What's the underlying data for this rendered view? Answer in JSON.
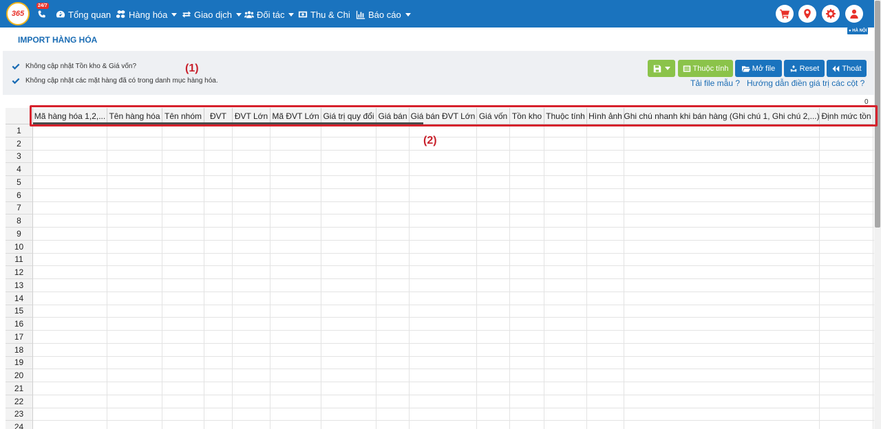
{
  "app": {
    "logo_text": "365",
    "phone_badge": "24/7"
  },
  "nav": {
    "items": [
      {
        "label": "Tổng quan",
        "icon": "dashboard-icon",
        "dropdown": false
      },
      {
        "label": "Hàng hóa",
        "icon": "cubes-icon",
        "dropdown": true
      },
      {
        "label": "Giao dịch",
        "icon": "exchange-icon",
        "dropdown": true
      },
      {
        "label": "Đối tác",
        "icon": "users-icon",
        "dropdown": true
      },
      {
        "label": "Thu & Chi",
        "icon": "money-icon",
        "dropdown": false
      },
      {
        "label": "Báo cáo",
        "icon": "bar-chart-icon",
        "dropdown": true
      }
    ],
    "right_icons": [
      "cart-icon",
      "map-marker-icon",
      "gear-icon",
      "user-icon"
    ]
  },
  "page": {
    "title": "IMPORT HÀNG HÓA",
    "region": "HÀ NỘI"
  },
  "options": {
    "opt1": "Không cập nhật Tồn kho & Giá vốn?",
    "opt2": "Không cập nhật các mặt hàng đã có trong danh mục hàng hóa.",
    "annot1": "(1)",
    "annot2": "(2)"
  },
  "toolbar": {
    "save_icon": "save-icon",
    "attr_label": "Thuộc tính",
    "open_label": "Mở file",
    "reset_label": "Reset",
    "exit_label": "Thoát",
    "template_link": "Tải file mẫu ?",
    "guide_link": "Hướng dẫn điền giá trị các cột ?"
  },
  "grid": {
    "count": "0",
    "columns": [
      "Mã hàng hóa 1,2,...",
      "Tên hàng hóa",
      "Tên nhóm",
      "ĐVT",
      "ĐVT Lớn",
      "Mã ĐVT Lớn",
      "Giá trị quy đổi",
      "Giá bán",
      "Giá bán ĐVT Lớn",
      "Giá vốn",
      "Tồn kho",
      "Thuộc tính",
      "Hình ảnh",
      "Ghi chú nhanh khi bán hàng (Ghi chú 1, Ghi chú 2,...)",
      "Định mức tồn"
    ],
    "rows": [
      "1",
      "2",
      "3",
      "4",
      "5",
      "6",
      "7",
      "8",
      "9",
      "10",
      "11",
      "12",
      "13",
      "14",
      "15",
      "16",
      "17",
      "18",
      "19",
      "20",
      "21",
      "22",
      "23",
      "24"
    ]
  },
  "colors": {
    "nav_bg": "#1a73be",
    "accent_red": "#d6212c",
    "button_green": "#8bc34a",
    "button_blue": "#1a73be"
  }
}
